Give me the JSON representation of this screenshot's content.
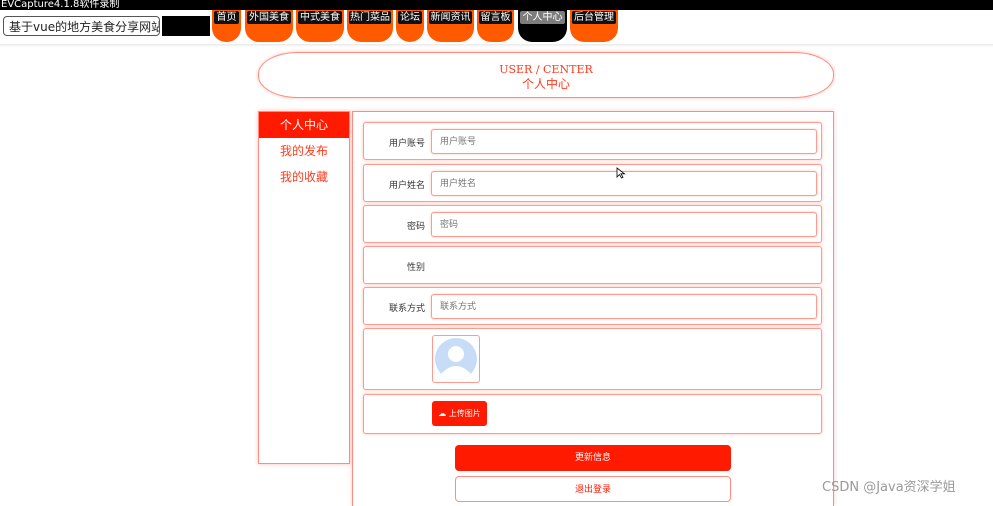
{
  "recorder": {
    "title": "EVCapture4.1.8软件录制"
  },
  "header": {
    "site_title": "基于vue的地方美食分享网站"
  },
  "nav": {
    "items": [
      {
        "label": "首页"
      },
      {
        "label": "外国美食"
      },
      {
        "label": "中式美食"
      },
      {
        "label": "热门菜品"
      },
      {
        "label": "论坛"
      },
      {
        "label": "新闻资讯"
      },
      {
        "label": "留言板"
      },
      {
        "label": "个人中心"
      },
      {
        "label": "后台管理"
      }
    ],
    "active": "个人中心",
    "accent_color": "#ff5a00"
  },
  "page_title": {
    "en": "USER / CENTER",
    "cn": "个人中心"
  },
  "sidebar": {
    "items": [
      {
        "label": "个人中心"
      },
      {
        "label": "我的发布"
      },
      {
        "label": "我的收藏"
      }
    ]
  },
  "form": {
    "account": {
      "label": "用户账号",
      "placeholder": "用户账号",
      "value": ""
    },
    "name": {
      "label": "用户姓名",
      "placeholder": "用户姓名",
      "value": ""
    },
    "password": {
      "label": "密码",
      "placeholder": "密码",
      "value": ""
    },
    "gender": {
      "label": "性别"
    },
    "contact": {
      "label": "联系方式",
      "placeholder": "联系方式",
      "value": ""
    },
    "avatar_icon": "default-avatar-icon",
    "upload_label": "上传图片",
    "update_label": "更新信息",
    "logout_label": "退出登录"
  },
  "theme": {
    "primary": "#ff1a00",
    "border": "#ff8c80"
  },
  "watermark": "CSDN @Java资深学姐"
}
